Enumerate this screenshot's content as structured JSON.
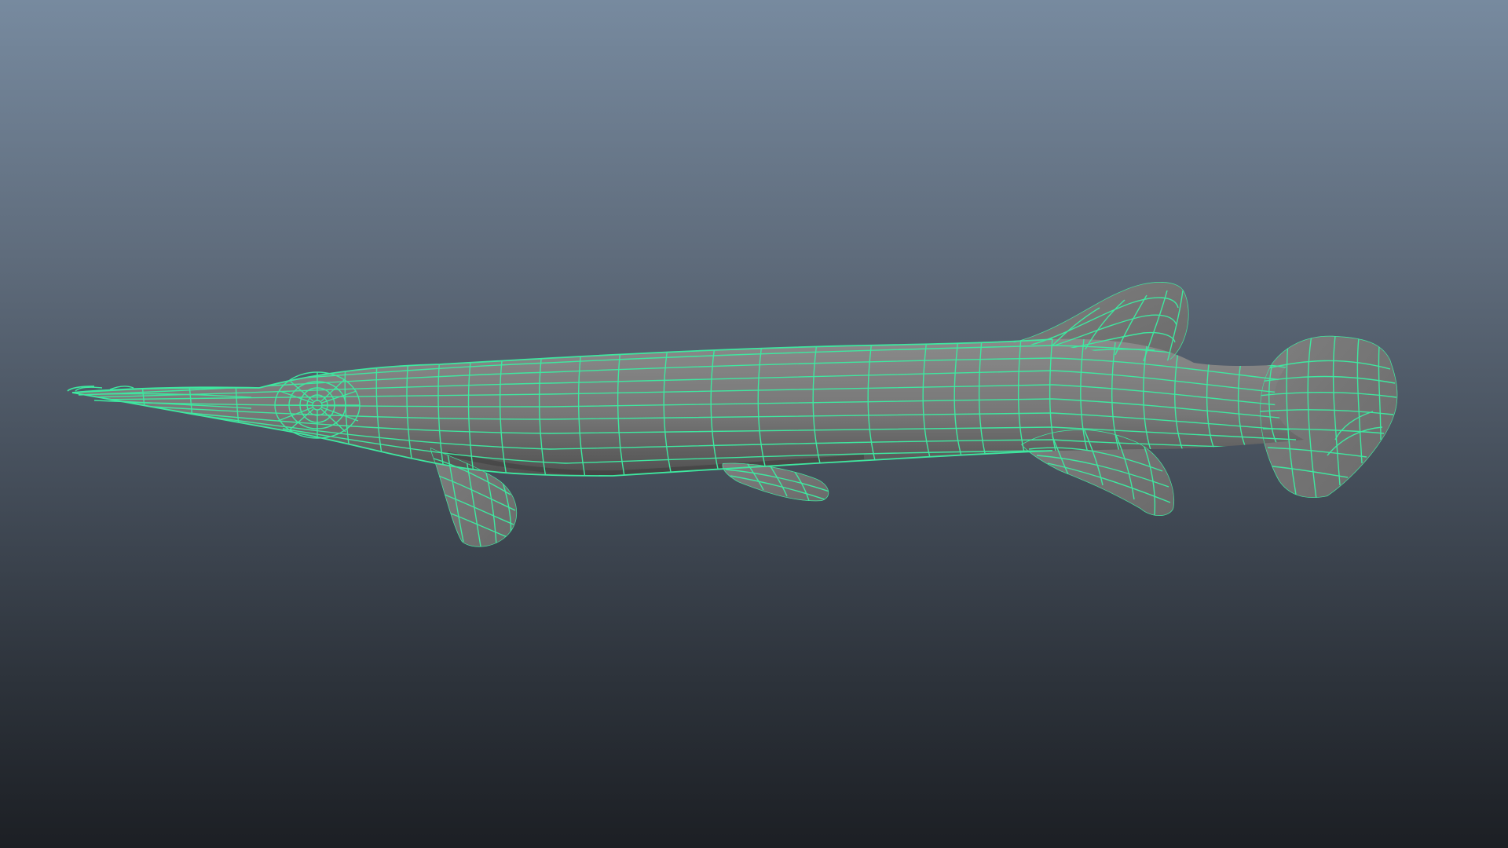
{
  "viewport": {
    "background_top": "#778a9f",
    "background_bottom": "#1c1f24"
  },
  "model": {
    "subject": "gar-fish",
    "display_mode": "wireframe-on-shaded",
    "shaded_color": "#7a7a7a",
    "wireframe_color": "#3ee8a0",
    "selected": true
  }
}
